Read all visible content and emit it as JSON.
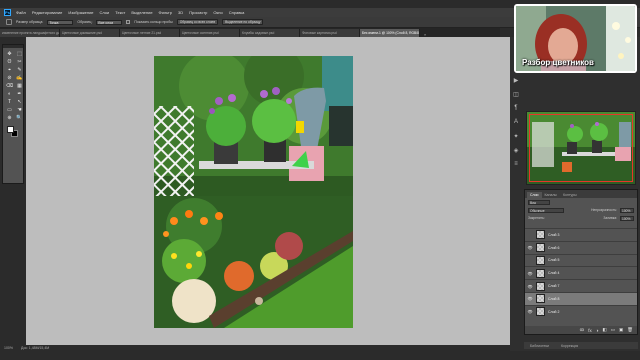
{
  "menu": {
    "logo": "Ps",
    "items": [
      "Файл",
      "Редактирование",
      "Изображение",
      "Слои",
      "Текст",
      "Выделение",
      "Фильтр",
      "3D",
      "Просмотр",
      "Окно",
      "Справка"
    ]
  },
  "options": {
    "size_label": "Размер образца:",
    "size_value": "Точка",
    "layer_label": "Образец:",
    "layer_value": "Все слои",
    "show_ring_label": "Показать кольцо пробы",
    "btn_all_layers": "Образец со всех слоев",
    "btn_ring": "Выделение по образцу"
  },
  "tabs": [
    {
      "label": "изменение проекта ландшафтного дизайна.psd",
      "active": false
    },
    {
      "label": "Цветочные домашние.psd",
      "active": false
    },
    {
      "label": "Цветочные летние 21.psd",
      "active": false
    },
    {
      "label": "Цветочные осенние.psd",
      "active": false
    },
    {
      "label": "Клумбы садовые.psd",
      "active": false
    },
    {
      "label": "Фоновые картинки.psd",
      "active": false
    },
    {
      "label": "Без имени-1 @ 100% (Слой 8, RGB/8#)",
      "active": true
    }
  ],
  "tabs_more": "»",
  "tools": [
    "✥",
    "⬚",
    "ʘ",
    "✂",
    "⌖",
    "✎",
    "⊘",
    "✍",
    "⌫",
    "▦",
    "◐",
    "✒",
    "T",
    "↖",
    "▭",
    "☚",
    "⊕",
    "🔍"
  ],
  "status": {
    "zoom": "100%",
    "doc": "Док: 1,48М/15,4М"
  },
  "webcam": {
    "caption": "Разбор цветников"
  },
  "side_icons": [
    "▶",
    "◫",
    "¶",
    "A",
    "✦",
    "◈",
    "≡"
  ],
  "layers": {
    "tabs": [
      "Слои",
      "Каналы",
      "Контуры"
    ],
    "active_tab": "Слои",
    "filter_label": "Вид",
    "blend_mode": "Обычные",
    "opacity_label": "Непрозрачность:",
    "opacity_value": "100%",
    "lock_label": "Закрепить:",
    "fill_label": "Заливка:",
    "fill_value": "100%",
    "items": [
      {
        "name": "Слой 3",
        "visible": false,
        "selected": false
      },
      {
        "name": "Слой 6",
        "visible": true,
        "selected": false
      },
      {
        "name": "Слой 5",
        "visible": false,
        "selected": false
      },
      {
        "name": "Слой 4",
        "visible": true,
        "selected": false
      },
      {
        "name": "Слой 7",
        "visible": true,
        "selected": false
      },
      {
        "name": "Слой 8",
        "visible": true,
        "selected": true
      },
      {
        "name": "Слой 2",
        "visible": true,
        "selected": false
      }
    ],
    "foot_icons": [
      "ꝏ",
      "fx",
      "◑",
      "◧",
      "▭",
      "▣",
      "🗑"
    ]
  },
  "bottom_tabs": [
    "Библиотеки",
    "Коррекция"
  ]
}
